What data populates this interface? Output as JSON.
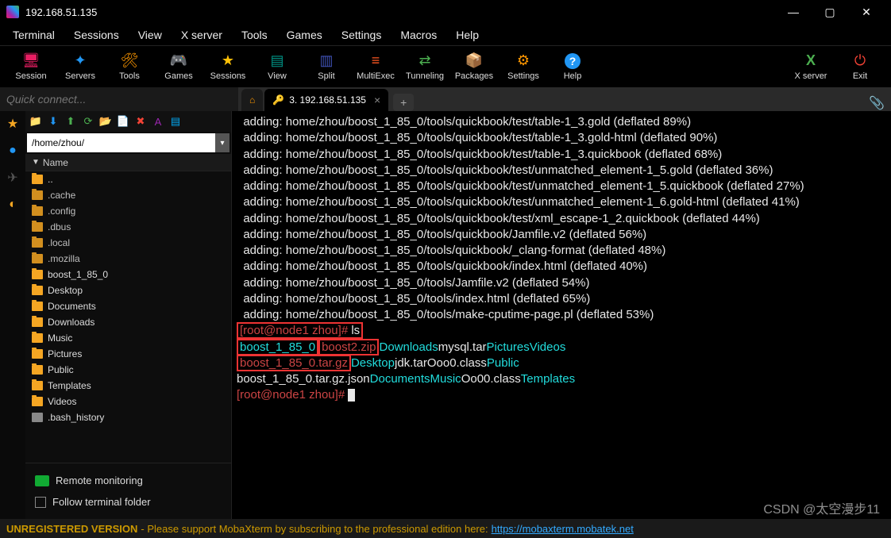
{
  "window": {
    "title": "192.168.51.135",
    "min": "—",
    "max": "▢",
    "close": "✕"
  },
  "menu": [
    "Terminal",
    "Sessions",
    "View",
    "X server",
    "Tools",
    "Games",
    "Settings",
    "Macros",
    "Help"
  ],
  "toolbar": [
    {
      "label": "Session",
      "color": "#e91e63",
      "glyph": "🖥"
    },
    {
      "label": "Servers",
      "color": "#2196f3",
      "glyph": "✦"
    },
    {
      "label": "Tools",
      "color": "#ff9800",
      "glyph": "🛠"
    },
    {
      "label": "Games",
      "color": "#9e9e9e",
      "glyph": "🎮"
    },
    {
      "label": "Sessions",
      "color": "#ffc107",
      "glyph": "★"
    },
    {
      "label": "View",
      "color": "#009688",
      "glyph": "▤"
    },
    {
      "label": "Split",
      "color": "#3f51b5",
      "glyph": "▥"
    },
    {
      "label": "MultiExec",
      "color": "#ff5722",
      "glyph": "≡"
    },
    {
      "label": "Tunneling",
      "color": "#4caf50",
      "glyph": "⇄"
    },
    {
      "label": "Packages",
      "color": "#03a9f4",
      "glyph": "📦"
    },
    {
      "label": "Settings",
      "color": "#ff9800",
      "glyph": "⚙"
    },
    {
      "label": "Help",
      "color": "#2196f3",
      "glyph": "?"
    }
  ],
  "toolbar_right": [
    {
      "label": "X server",
      "color": "#4caf50",
      "glyph": "X"
    },
    {
      "label": "Exit",
      "color": "#f44336",
      "glyph": "⏻"
    }
  ],
  "quickconnect": {
    "placeholder": "Quick connect..."
  },
  "tabs": {
    "home_glyph": "⌂",
    "active": {
      "icon": "🔑",
      "label": "3. 192.168.51.135"
    },
    "newtab": "+",
    "attach": "📎"
  },
  "sidebar": {
    "path": "/home/zhou/",
    "header": "Name",
    "items": [
      {
        "name": "..",
        "type": "up"
      },
      {
        "name": ".cache",
        "type": "dot"
      },
      {
        "name": ".config",
        "type": "dot"
      },
      {
        "name": ".dbus",
        "type": "dot"
      },
      {
        "name": ".local",
        "type": "dot"
      },
      {
        "name": ".mozilla",
        "type": "dot"
      },
      {
        "name": "boost_1_85_0",
        "type": "folder"
      },
      {
        "name": "Desktop",
        "type": "folder"
      },
      {
        "name": "Documents",
        "type": "folder"
      },
      {
        "name": "Downloads",
        "type": "folder"
      },
      {
        "name": "Music",
        "type": "folder"
      },
      {
        "name": "Pictures",
        "type": "folder"
      },
      {
        "name": "Public",
        "type": "folder"
      },
      {
        "name": "Templates",
        "type": "folder"
      },
      {
        "name": "Videos",
        "type": "folder"
      },
      {
        "name": ".bash_history",
        "type": "file"
      }
    ],
    "remote_monitoring": "Remote monitoring",
    "follow_terminal": "Follow terminal folder"
  },
  "terminal": {
    "lines": [
      "  adding: home/zhou/boost_1_85_0/tools/quickbook/test/table-1_3.gold (deflated 89%)",
      "  adding: home/zhou/boost_1_85_0/tools/quickbook/test/table-1_3.gold-html (deflated 90%)",
      "  adding: home/zhou/boost_1_85_0/tools/quickbook/test/table-1_3.quickbook (deflated 68%)",
      "  adding: home/zhou/boost_1_85_0/tools/quickbook/test/unmatched_element-1_5.gold (deflated 36%)",
      "  adding: home/zhou/boost_1_85_0/tools/quickbook/test/unmatched_element-1_5.quickbook (deflated 27%)",
      "  adding: home/zhou/boost_1_85_0/tools/quickbook/test/unmatched_element-1_6.gold-html (deflated 41%)",
      "  adding: home/zhou/boost_1_85_0/tools/quickbook/test/xml_escape-1_2.quickbook (deflated 44%)",
      "  adding: home/zhou/boost_1_85_0/tools/quickbook/Jamfile.v2 (deflated 56%)",
      "  adding: home/zhou/boost_1_85_0/tools/quickbook/_clang-format (deflated 48%)",
      "  adding: home/zhou/boost_1_85_0/tools/quickbook/index.html (deflated 40%)",
      "  adding: home/zhou/boost_1_85_0/tools/Jamfile.v2 (deflated 54%)",
      "  adding: home/zhou/boost_1_85_0/tools/index.html (deflated 65%)",
      "  adding: home/zhou/boost_1_85_0/tools/make-cputime-page.pl (deflated 53%)"
    ],
    "prompt1": "[root@node1 zhou]# ",
    "cmd1": "ls",
    "ls": {
      "r1": [
        "boost_1_85_0",
        "boost2.zip",
        "Downloads",
        "mysql.tar",
        "Pictures",
        "Videos"
      ],
      "r2": [
        "boost_1_85_0.tar.gz",
        "Desktop",
        "jdk.tar",
        "Ooo0.class",
        "Public",
        ""
      ],
      "r3": [
        "boost_1_85_0.tar.gz.json",
        "Documents",
        "Music",
        "Oo00.class",
        "Templates",
        ""
      ]
    },
    "prompt2": "[root@node1 zhou]# "
  },
  "status": {
    "unreg": "UNREGISTERED VERSION",
    "text": "  -  Please support MobaXterm by subscribing to the professional edition here:  ",
    "url": "https://mobaxterm.mobatek.net"
  },
  "watermark": "CSDN @太空漫步11"
}
